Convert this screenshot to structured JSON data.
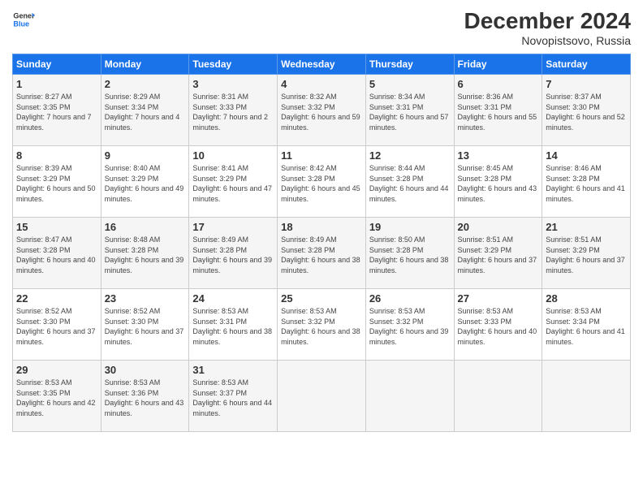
{
  "logo": {
    "line1": "General",
    "line2": "Blue"
  },
  "title": "December 2024",
  "subtitle": "Novopistsovo, Russia",
  "days_header": [
    "Sunday",
    "Monday",
    "Tuesday",
    "Wednesday",
    "Thursday",
    "Friday",
    "Saturday"
  ],
  "weeks": [
    [
      {
        "day": "1",
        "sunrise": "Sunrise: 8:27 AM",
        "sunset": "Sunset: 3:35 PM",
        "daylight": "Daylight: 7 hours and 7 minutes."
      },
      {
        "day": "2",
        "sunrise": "Sunrise: 8:29 AM",
        "sunset": "Sunset: 3:34 PM",
        "daylight": "Daylight: 7 hours and 4 minutes."
      },
      {
        "day": "3",
        "sunrise": "Sunrise: 8:31 AM",
        "sunset": "Sunset: 3:33 PM",
        "daylight": "Daylight: 7 hours and 2 minutes."
      },
      {
        "day": "4",
        "sunrise": "Sunrise: 8:32 AM",
        "sunset": "Sunset: 3:32 PM",
        "daylight": "Daylight: 6 hours and 59 minutes."
      },
      {
        "day": "5",
        "sunrise": "Sunrise: 8:34 AM",
        "sunset": "Sunset: 3:31 PM",
        "daylight": "Daylight: 6 hours and 57 minutes."
      },
      {
        "day": "6",
        "sunrise": "Sunrise: 8:36 AM",
        "sunset": "Sunset: 3:31 PM",
        "daylight": "Daylight: 6 hours and 55 minutes."
      },
      {
        "day": "7",
        "sunrise": "Sunrise: 8:37 AM",
        "sunset": "Sunset: 3:30 PM",
        "daylight": "Daylight: 6 hours and 52 minutes."
      }
    ],
    [
      {
        "day": "8",
        "sunrise": "Sunrise: 8:39 AM",
        "sunset": "Sunset: 3:29 PM",
        "daylight": "Daylight: 6 hours and 50 minutes."
      },
      {
        "day": "9",
        "sunrise": "Sunrise: 8:40 AM",
        "sunset": "Sunset: 3:29 PM",
        "daylight": "Daylight: 6 hours and 49 minutes."
      },
      {
        "day": "10",
        "sunrise": "Sunrise: 8:41 AM",
        "sunset": "Sunset: 3:29 PM",
        "daylight": "Daylight: 6 hours and 47 minutes."
      },
      {
        "day": "11",
        "sunrise": "Sunrise: 8:42 AM",
        "sunset": "Sunset: 3:28 PM",
        "daylight": "Daylight: 6 hours and 45 minutes."
      },
      {
        "day": "12",
        "sunrise": "Sunrise: 8:44 AM",
        "sunset": "Sunset: 3:28 PM",
        "daylight": "Daylight: 6 hours and 44 minutes."
      },
      {
        "day": "13",
        "sunrise": "Sunrise: 8:45 AM",
        "sunset": "Sunset: 3:28 PM",
        "daylight": "Daylight: 6 hours and 43 minutes."
      },
      {
        "day": "14",
        "sunrise": "Sunrise: 8:46 AM",
        "sunset": "Sunset: 3:28 PM",
        "daylight": "Daylight: 6 hours and 41 minutes."
      }
    ],
    [
      {
        "day": "15",
        "sunrise": "Sunrise: 8:47 AM",
        "sunset": "Sunset: 3:28 PM",
        "daylight": "Daylight: 6 hours and 40 minutes."
      },
      {
        "day": "16",
        "sunrise": "Sunrise: 8:48 AM",
        "sunset": "Sunset: 3:28 PM",
        "daylight": "Daylight: 6 hours and 39 minutes."
      },
      {
        "day": "17",
        "sunrise": "Sunrise: 8:49 AM",
        "sunset": "Sunset: 3:28 PM",
        "daylight": "Daylight: 6 hours and 39 minutes."
      },
      {
        "day": "18",
        "sunrise": "Sunrise: 8:49 AM",
        "sunset": "Sunset: 3:28 PM",
        "daylight": "Daylight: 6 hours and 38 minutes."
      },
      {
        "day": "19",
        "sunrise": "Sunrise: 8:50 AM",
        "sunset": "Sunset: 3:28 PM",
        "daylight": "Daylight: 6 hours and 38 minutes."
      },
      {
        "day": "20",
        "sunrise": "Sunrise: 8:51 AM",
        "sunset": "Sunset: 3:29 PM",
        "daylight": "Daylight: 6 hours and 37 minutes."
      },
      {
        "day": "21",
        "sunrise": "Sunrise: 8:51 AM",
        "sunset": "Sunset: 3:29 PM",
        "daylight": "Daylight: 6 hours and 37 minutes."
      }
    ],
    [
      {
        "day": "22",
        "sunrise": "Sunrise: 8:52 AM",
        "sunset": "Sunset: 3:30 PM",
        "daylight": "Daylight: 6 hours and 37 minutes."
      },
      {
        "day": "23",
        "sunrise": "Sunrise: 8:52 AM",
        "sunset": "Sunset: 3:30 PM",
        "daylight": "Daylight: 6 hours and 37 minutes."
      },
      {
        "day": "24",
        "sunrise": "Sunrise: 8:53 AM",
        "sunset": "Sunset: 3:31 PM",
        "daylight": "Daylight: 6 hours and 38 minutes."
      },
      {
        "day": "25",
        "sunrise": "Sunrise: 8:53 AM",
        "sunset": "Sunset: 3:32 PM",
        "daylight": "Daylight: 6 hours and 38 minutes."
      },
      {
        "day": "26",
        "sunrise": "Sunrise: 8:53 AM",
        "sunset": "Sunset: 3:32 PM",
        "daylight": "Daylight: 6 hours and 39 minutes."
      },
      {
        "day": "27",
        "sunrise": "Sunrise: 8:53 AM",
        "sunset": "Sunset: 3:33 PM",
        "daylight": "Daylight: 6 hours and 40 minutes."
      },
      {
        "day": "28",
        "sunrise": "Sunrise: 8:53 AM",
        "sunset": "Sunset: 3:34 PM",
        "daylight": "Daylight: 6 hours and 41 minutes."
      }
    ],
    [
      {
        "day": "29",
        "sunrise": "Sunrise: 8:53 AM",
        "sunset": "Sunset: 3:35 PM",
        "daylight": "Daylight: 6 hours and 42 minutes."
      },
      {
        "day": "30",
        "sunrise": "Sunrise: 8:53 AM",
        "sunset": "Sunset: 3:36 PM",
        "daylight": "Daylight: 6 hours and 43 minutes."
      },
      {
        "day": "31",
        "sunrise": "Sunrise: 8:53 AM",
        "sunset": "Sunset: 3:37 PM",
        "daylight": "Daylight: 6 hours and 44 minutes."
      },
      null,
      null,
      null,
      null
    ]
  ]
}
